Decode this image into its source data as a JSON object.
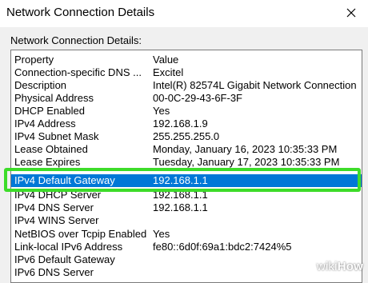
{
  "window": {
    "title": "Network Connection Details",
    "close_icon": "close-icon"
  },
  "group_label": "Network Connection Details:",
  "table": {
    "columns": {
      "property": "Property",
      "value": "Value"
    },
    "rows": [
      {
        "property": "Connection-specific DNS ...",
        "value": "Excitel"
      },
      {
        "property": "Description",
        "value": "Intel(R) 82574L Gigabit Network Connection"
      },
      {
        "property": "Physical Address",
        "value": "00-0C-29-43-6F-3F"
      },
      {
        "property": "DHCP Enabled",
        "value": "Yes"
      },
      {
        "property": "IPv4 Address",
        "value": "192.168.1.9"
      },
      {
        "property": "IPv4 Subnet Mask",
        "value": "255.255.255.0"
      },
      {
        "property": "Lease Obtained",
        "value": "Monday, January 16, 2023 10:35:33 PM"
      },
      {
        "property": "Lease Expires",
        "value": "Tuesday, January 17, 2023 10:35:33 PM"
      },
      {
        "property": "IPv4 Default Gateway",
        "value": "192.168.1.1",
        "selected": true
      },
      {
        "property": "IPv4 DHCP Server",
        "value": "192.168.1.1"
      },
      {
        "property": "IPv4 DNS Server",
        "value": "192.168.1.1"
      },
      {
        "property": "IPv4 WINS Server",
        "value": ""
      },
      {
        "property": "NetBIOS over Tcpip Enabled",
        "value": "Yes"
      },
      {
        "property": "Link-local IPv6 Address",
        "value": "fe80::6d0f:69a1:bdc2:7424%5"
      },
      {
        "property": "IPv6 Default Gateway",
        "value": ""
      },
      {
        "property": "IPv6 DNS Server",
        "value": ""
      }
    ]
  },
  "highlight_color": "#3ddc29",
  "selection_color": "#0078d7",
  "watermark": {
    "prefix": "wiki",
    "suffix": "How"
  }
}
